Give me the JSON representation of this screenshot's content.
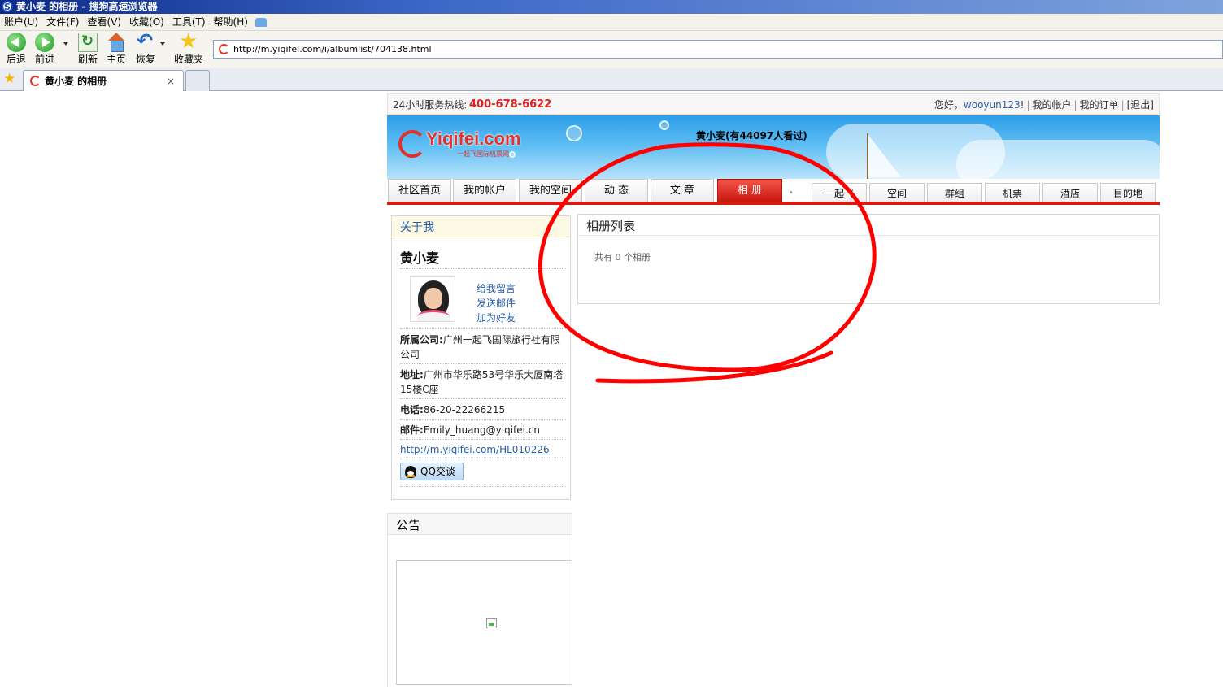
{
  "browser": {
    "window_title": "黄小麦 的相册 - 搜狗高速浏览器",
    "menu": [
      "账户(U)",
      "文件(F)",
      "查看(V)",
      "收藏(O)",
      "工具(T)",
      "帮助(H)"
    ],
    "toolbar": {
      "back": "后退",
      "forward": "前进",
      "refresh": "刷新",
      "home": "主页",
      "restore": "恢复",
      "favorites": "收藏夹"
    },
    "url": "http://m.yiqifei.com/i/albumlist/704138.html",
    "tab_title": "黄小麦 的相册",
    "tab_close": "×"
  },
  "site": {
    "hotline_label": "24小时服务热线:",
    "hotline": "400-678-6622",
    "greeting": "您好，",
    "username": "wooyun123",
    "greet_suffix": "!",
    "my_account": "我的帐户",
    "my_orders": "我的订单",
    "logout": "[退出]",
    "logo_text": "Yiqifei.com",
    "logo_sub": "一起飞国际机票网",
    "banner_title": "黄小麦(有44097人看过)",
    "nav_primary": [
      "社区首页",
      "我的帐户",
      "我的空间",
      "动 态",
      "文 章",
      "相 册"
    ],
    "nav_secondary": [
      "一起飞",
      "空间",
      "群组",
      "机票",
      "酒店",
      "目的地"
    ],
    "active_nav": "相 册"
  },
  "about": {
    "heading": "关于我",
    "name": "黄小麦",
    "links": [
      "给我留言",
      "发送邮件",
      "加为好友"
    ],
    "company_label": "所属公司:",
    "company": "广州一起飞国际旅行社有限公司",
    "address_label": "地址:",
    "address": "广州市华乐路53号华乐大厦南塔15楼C座",
    "phone_label": "电话:",
    "phone": "86-20-22266215",
    "email_label": "邮件:",
    "email": "Emily_huang@yiqifei.cn",
    "profile_url": "http://m.yiqifei.com/HL010226",
    "qq_button": "QQ交谈"
  },
  "notice": {
    "heading": "公告"
  },
  "albums": {
    "heading": "相册列表",
    "count_text": "共有 0 个相册"
  },
  "colors": {
    "brand_red": "#d51b12",
    "link_blue": "#2a5ea8",
    "annotation": "#ff0000"
  }
}
